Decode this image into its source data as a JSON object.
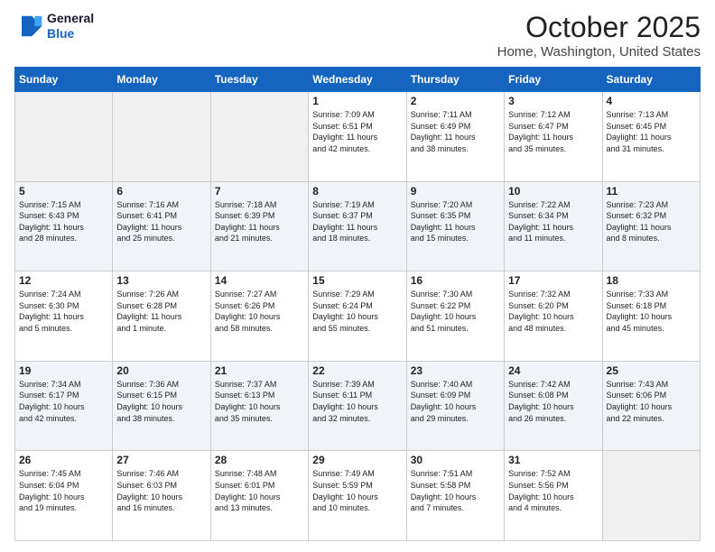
{
  "header": {
    "logo_line1": "General",
    "logo_line2": "Blue",
    "month": "October 2025",
    "location": "Home, Washington, United States"
  },
  "weekdays": [
    "Sunday",
    "Monday",
    "Tuesday",
    "Wednesday",
    "Thursday",
    "Friday",
    "Saturday"
  ],
  "weeks": [
    [
      {
        "day": "",
        "info": ""
      },
      {
        "day": "",
        "info": ""
      },
      {
        "day": "",
        "info": ""
      },
      {
        "day": "1",
        "info": "Sunrise: 7:09 AM\nSunset: 6:51 PM\nDaylight: 11 hours\nand 42 minutes."
      },
      {
        "day": "2",
        "info": "Sunrise: 7:11 AM\nSunset: 6:49 PM\nDaylight: 11 hours\nand 38 minutes."
      },
      {
        "day": "3",
        "info": "Sunrise: 7:12 AM\nSunset: 6:47 PM\nDaylight: 11 hours\nand 35 minutes."
      },
      {
        "day": "4",
        "info": "Sunrise: 7:13 AM\nSunset: 6:45 PM\nDaylight: 11 hours\nand 31 minutes."
      }
    ],
    [
      {
        "day": "5",
        "info": "Sunrise: 7:15 AM\nSunset: 6:43 PM\nDaylight: 11 hours\nand 28 minutes."
      },
      {
        "day": "6",
        "info": "Sunrise: 7:16 AM\nSunset: 6:41 PM\nDaylight: 11 hours\nand 25 minutes."
      },
      {
        "day": "7",
        "info": "Sunrise: 7:18 AM\nSunset: 6:39 PM\nDaylight: 11 hours\nand 21 minutes."
      },
      {
        "day": "8",
        "info": "Sunrise: 7:19 AM\nSunset: 6:37 PM\nDaylight: 11 hours\nand 18 minutes."
      },
      {
        "day": "9",
        "info": "Sunrise: 7:20 AM\nSunset: 6:35 PM\nDaylight: 11 hours\nand 15 minutes."
      },
      {
        "day": "10",
        "info": "Sunrise: 7:22 AM\nSunset: 6:34 PM\nDaylight: 11 hours\nand 11 minutes."
      },
      {
        "day": "11",
        "info": "Sunrise: 7:23 AM\nSunset: 6:32 PM\nDaylight: 11 hours\nand 8 minutes."
      }
    ],
    [
      {
        "day": "12",
        "info": "Sunrise: 7:24 AM\nSunset: 6:30 PM\nDaylight: 11 hours\nand 5 minutes."
      },
      {
        "day": "13",
        "info": "Sunrise: 7:26 AM\nSunset: 6:28 PM\nDaylight: 11 hours\nand 1 minute."
      },
      {
        "day": "14",
        "info": "Sunrise: 7:27 AM\nSunset: 6:26 PM\nDaylight: 10 hours\nand 58 minutes."
      },
      {
        "day": "15",
        "info": "Sunrise: 7:29 AM\nSunset: 6:24 PM\nDaylight: 10 hours\nand 55 minutes."
      },
      {
        "day": "16",
        "info": "Sunrise: 7:30 AM\nSunset: 6:22 PM\nDaylight: 10 hours\nand 51 minutes."
      },
      {
        "day": "17",
        "info": "Sunrise: 7:32 AM\nSunset: 6:20 PM\nDaylight: 10 hours\nand 48 minutes."
      },
      {
        "day": "18",
        "info": "Sunrise: 7:33 AM\nSunset: 6:18 PM\nDaylight: 10 hours\nand 45 minutes."
      }
    ],
    [
      {
        "day": "19",
        "info": "Sunrise: 7:34 AM\nSunset: 6:17 PM\nDaylight: 10 hours\nand 42 minutes."
      },
      {
        "day": "20",
        "info": "Sunrise: 7:36 AM\nSunset: 6:15 PM\nDaylight: 10 hours\nand 38 minutes."
      },
      {
        "day": "21",
        "info": "Sunrise: 7:37 AM\nSunset: 6:13 PM\nDaylight: 10 hours\nand 35 minutes."
      },
      {
        "day": "22",
        "info": "Sunrise: 7:39 AM\nSunset: 6:11 PM\nDaylight: 10 hours\nand 32 minutes."
      },
      {
        "day": "23",
        "info": "Sunrise: 7:40 AM\nSunset: 6:09 PM\nDaylight: 10 hours\nand 29 minutes."
      },
      {
        "day": "24",
        "info": "Sunrise: 7:42 AM\nSunset: 6:08 PM\nDaylight: 10 hours\nand 26 minutes."
      },
      {
        "day": "25",
        "info": "Sunrise: 7:43 AM\nSunset: 6:06 PM\nDaylight: 10 hours\nand 22 minutes."
      }
    ],
    [
      {
        "day": "26",
        "info": "Sunrise: 7:45 AM\nSunset: 6:04 PM\nDaylight: 10 hours\nand 19 minutes."
      },
      {
        "day": "27",
        "info": "Sunrise: 7:46 AM\nSunset: 6:03 PM\nDaylight: 10 hours\nand 16 minutes."
      },
      {
        "day": "28",
        "info": "Sunrise: 7:48 AM\nSunset: 6:01 PM\nDaylight: 10 hours\nand 13 minutes."
      },
      {
        "day": "29",
        "info": "Sunrise: 7:49 AM\nSunset: 5:59 PM\nDaylight: 10 hours\nand 10 minutes."
      },
      {
        "day": "30",
        "info": "Sunrise: 7:51 AM\nSunset: 5:58 PM\nDaylight: 10 hours\nand 7 minutes."
      },
      {
        "day": "31",
        "info": "Sunrise: 7:52 AM\nSunset: 5:56 PM\nDaylight: 10 hours\nand 4 minutes."
      },
      {
        "day": "",
        "info": ""
      }
    ]
  ]
}
